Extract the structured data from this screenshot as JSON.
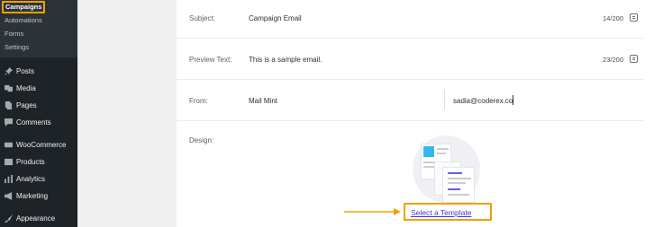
{
  "sidebar": {
    "submenu": [
      {
        "label": "Campaigns",
        "active": true
      },
      {
        "label": "Automations"
      },
      {
        "label": "Forms"
      },
      {
        "label": "Settings"
      }
    ],
    "menu": [
      {
        "label": "Posts",
        "icon": "pushpin-icon"
      },
      {
        "label": "Media",
        "icon": "media-icon"
      },
      {
        "label": "Pages",
        "icon": "pages-icon"
      },
      {
        "label": "Comments",
        "icon": "comment-icon"
      },
      {
        "label": "WooCommerce",
        "icon": "woocommerce-icon"
      },
      {
        "label": "Products",
        "icon": "products-icon"
      },
      {
        "label": "Analytics",
        "icon": "analytics-icon"
      },
      {
        "label": "Marketing",
        "icon": "megaphone-icon"
      },
      {
        "label": "Appearance",
        "icon": "brush-icon"
      }
    ]
  },
  "form": {
    "subject": {
      "label": "Subject:",
      "value": "Campaign Email",
      "count": "14/200"
    },
    "preview": {
      "label": "Preview Text:",
      "value": "This is a sample email.",
      "count": "23/200"
    },
    "from": {
      "label": "From:",
      "name": "Mail Mint",
      "email": "sadia@coderex.co"
    },
    "design": {
      "label": "Design:",
      "select_template": "Select a Template"
    }
  },
  "colors": {
    "sidebar_bg": "#1d2327",
    "highlight": "#f0a000",
    "link": "#3b33d9",
    "accent_blue": "#34b7f1",
    "accent_purple": "#6a5cf0"
  }
}
